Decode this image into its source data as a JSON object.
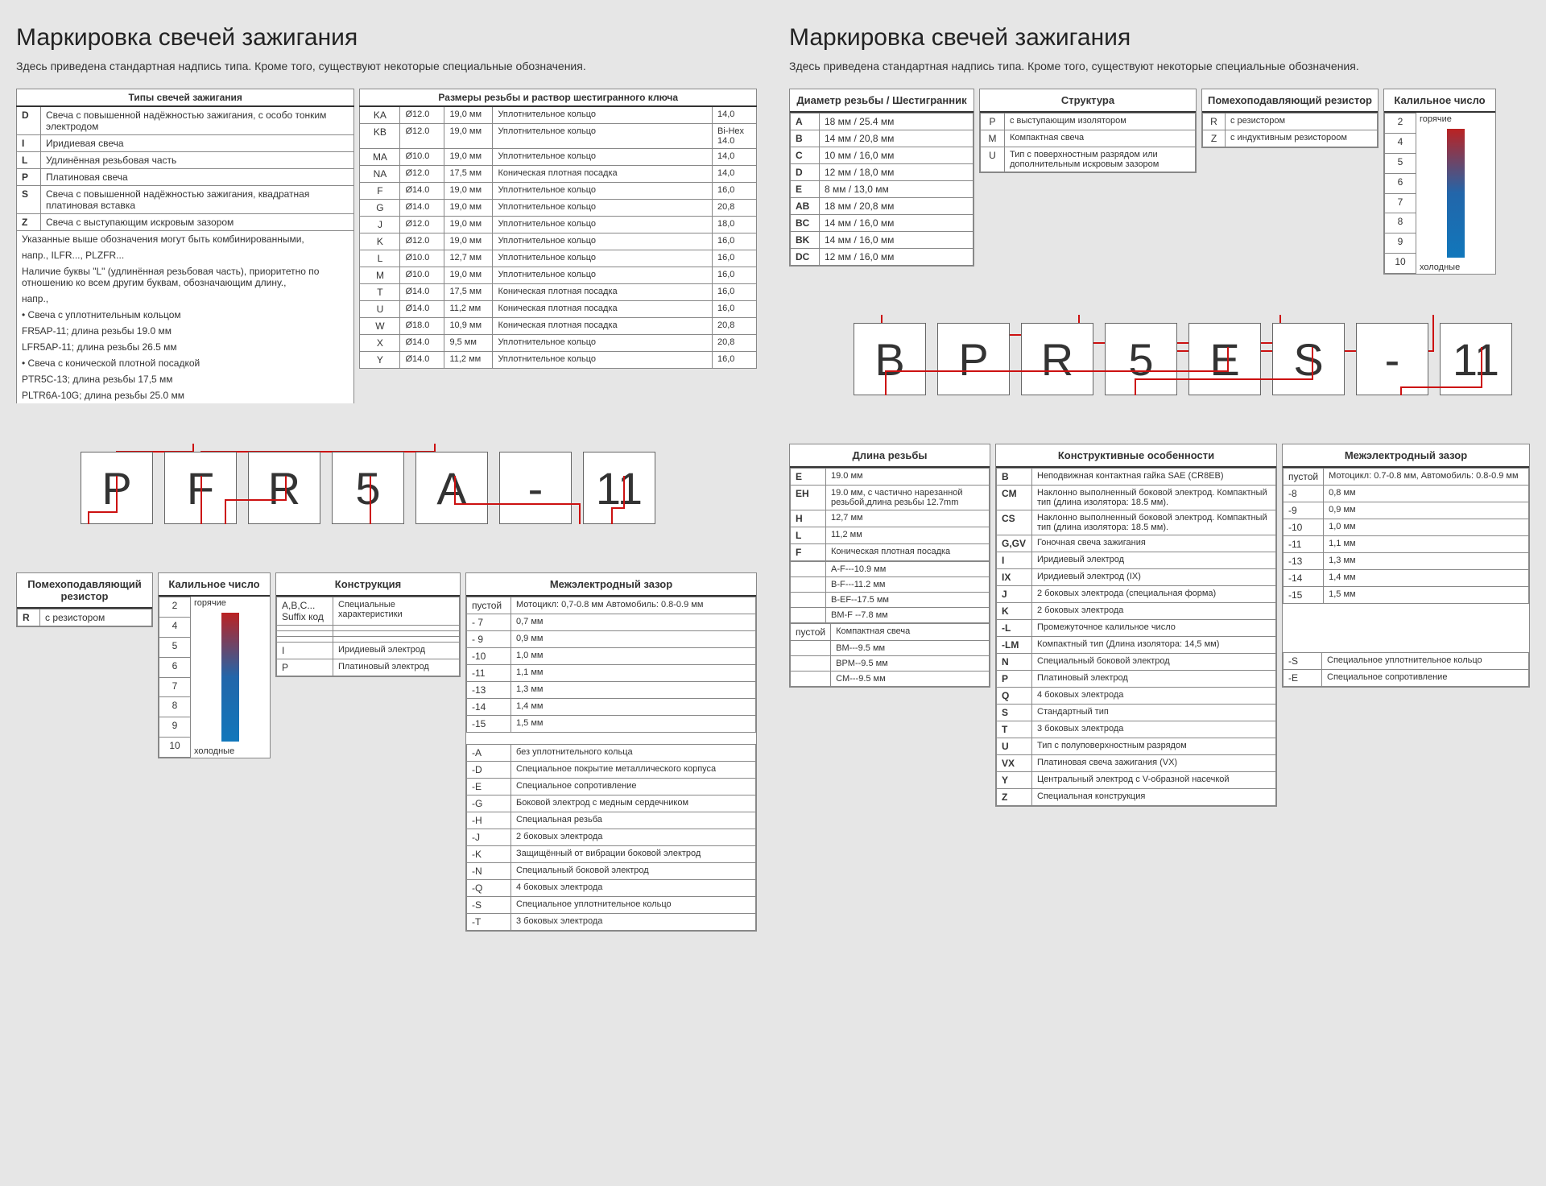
{
  "left": {
    "title": "Маркировка свечей зажигания",
    "subtitle": "Здесь приведена стандартная надпись типа. Кроме того, существуют некоторые специальные обозначения.",
    "tab1_hdr": "Типы свечей зажигания",
    "tab2_hdr": "Размеры резьбы и раствор шестигранного ключа",
    "types": [
      [
        "D",
        "Свеча с повышенной надёжностью зажигания, с особо тонким электродом"
      ],
      [
        "I",
        "Иридиевая свеча"
      ],
      [
        "L",
        "Удлинённая резьбовая часть"
      ],
      [
        "P",
        "Платиновая свеча"
      ],
      [
        "S",
        "Свеча с повышенной надёжностью зажигания, квадратная платиновая вставка"
      ],
      [
        "Z",
        "Свеча с выступающим искровым зазором"
      ]
    ],
    "types_notes": [
      "Указанные выше обозначения могут быть комбинированными,",
      "напр., ILFR..., PLZFR...",
      "Наличие буквы \"L\" (удлинённая резьбовая часть), приоритетно по отношению ко всем другим буквам, обозначающим длину.,",
      "напр.,",
      "• Свеча с уплотнительным кольцом",
      "  FR5AP-11; длина резьбы 19.0 мм",
      "  LFR5AP-11; длина резьбы 26.5 мм",
      "• Свеча с конической плотной посадкой",
      "  PTR5C-13; длина резьбы 17,5 мм",
      "  PLTR6A-10G; длина резьбы 25.0 мм"
    ],
    "sizes": [
      [
        "KA",
        "Ø12.0",
        "19,0 мм",
        "Уплотнительное кольцо",
        "14,0"
      ],
      [
        "KB",
        "Ø12.0",
        "19,0 мм",
        "Уплотнительное кольцо",
        "Bi-Hex 14.0"
      ],
      [
        "MA",
        "Ø10.0",
        "19,0 мм",
        "Уплотнительное кольцо",
        "14,0"
      ],
      [
        "NA",
        "Ø12.0",
        "17,5 мм",
        "Коническая плотная посадка",
        "14,0"
      ],
      [
        "F",
        "Ø14.0",
        "19,0 мм",
        "Уплотнительное кольцо",
        "16,0"
      ],
      [
        "G",
        "Ø14.0",
        "19,0 мм",
        "Уплотнительное кольцо",
        "20,8"
      ],
      [
        "J",
        "Ø12.0",
        "19,0 мм",
        "Уплотнительное кольцо",
        "18,0"
      ],
      [
        "K",
        "Ø12.0",
        "19,0 мм",
        "Уплотнительное кольцо",
        "16,0"
      ],
      [
        "L",
        "Ø10.0",
        "12,7 мм",
        "Уплотнительное кольцо",
        "16,0"
      ],
      [
        "M",
        "Ø10.0",
        "19,0 мм",
        "Уплотнительное кольцо",
        "16,0"
      ],
      [
        "T",
        "Ø14.0",
        "17,5 мм",
        "Коническая плотная посадка",
        "16,0"
      ],
      [
        "U",
        "Ø14.0",
        "11,2 мм",
        "Коническая плотная посадка",
        "16,0"
      ],
      [
        "W",
        "Ø18.0",
        "10,9 мм",
        "Коническая плотная посадка",
        "20,8"
      ],
      [
        "X",
        "Ø14.0",
        "9,5 мм",
        "Уплотнительное кольцо",
        "20,8"
      ],
      [
        "Y",
        "Ø14.0",
        "11,2 мм",
        "Уплотнительное кольцо",
        "16,0"
      ]
    ],
    "example": [
      "P",
      "F",
      "R",
      "5",
      "A",
      "-",
      "11"
    ],
    "resistor_hdr": "Помехоподавляющий резистор",
    "resistor": [
      [
        "R",
        "с резистором"
      ]
    ],
    "heat_hdr": "Калильное число",
    "heat_nums": [
      "2",
      "4",
      "5",
      "6",
      "7",
      "8",
      "9",
      "10"
    ],
    "heat_hot": "горячие",
    "heat_cold": "холодные",
    "constr_hdr": "Конструкция",
    "constr": [
      [
        "A,B,C...  Suffix код",
        "Специальные характеристики"
      ],
      [
        "",
        ""
      ],
      [
        "",
        ""
      ],
      [
        "",
        ""
      ],
      [
        "I",
        "Иридиевый электрод"
      ],
      [
        "P",
        "Платиновый электрод"
      ]
    ],
    "gap_hdr": "Межэлектродный зазор",
    "gap_main": [
      [
        "пустой",
        "Мотоцикл: 0,7-0.8 мм Автомобиль: 0.8-0.9 мм"
      ],
      [
        "- 7",
        "0,7 мм"
      ],
      [
        "- 9",
        "0,9 мм"
      ],
      [
        "-10",
        "1,0 мм"
      ],
      [
        "-11",
        "1,1 мм"
      ],
      [
        "-13",
        "1,3 мм"
      ],
      [
        "-14",
        "1,4 мм"
      ],
      [
        "-15",
        "1,5 мм"
      ]
    ],
    "gap_extra": [
      [
        "-A",
        "без уплотнительного кольца"
      ],
      [
        "-D",
        "Специальное покрытие металлического корпуса"
      ],
      [
        "-E",
        "Специальное сопротивление"
      ],
      [
        "-G",
        "Боковой электрод с медным сердечником"
      ],
      [
        "-H",
        "Специальная резьба"
      ],
      [
        "-J",
        "2 боковых электрода"
      ],
      [
        "-K",
        "Защищённый от вибрации боковой электрод"
      ],
      [
        "-N",
        "Специальный боковой электрод"
      ],
      [
        "-Q",
        "4 боковых электрода"
      ],
      [
        "-S",
        "Специальное уплотнительное кольцо"
      ],
      [
        "-T",
        "3 боковых электрода"
      ]
    ]
  },
  "right": {
    "title": "Маркировка свечей зажигания",
    "subtitle": "Здесь приведена стандартная надпись типа. Кроме того, существуют некоторые специальные обозначения.",
    "thread_hdr": "Диаметр резьбы / Шестигранник",
    "thread": [
      [
        "A",
        "18 мм / 25.4 мм"
      ],
      [
        "B",
        "14 мм / 20,8 мм"
      ],
      [
        "C",
        "10 мм / 16,0 мм"
      ],
      [
        "D",
        "12 мм / 18,0 мм"
      ],
      [
        "E",
        "8 мм / 13,0 мм"
      ],
      [
        "AB",
        "18 мм / 20,8 мм"
      ],
      [
        "BC",
        "14 мм / 16,0 мм"
      ],
      [
        "BK",
        "14 мм / 16,0 мм"
      ],
      [
        "DC",
        "12 мм / 16,0 мм"
      ]
    ],
    "struct_hdr": "Структура",
    "struct": [
      [
        "P",
        "с выступающим изолятором"
      ],
      [
        "M",
        "Компактная свеча"
      ],
      [
        "U",
        "Тип с поверхностным разрядом или дополнительным искровым зазором"
      ]
    ],
    "resistor_hdr": "Помехоподавляющий резистор",
    "resistor": [
      [
        "R",
        "с резистором"
      ],
      [
        "Z",
        "с индуктивным резистороом"
      ]
    ],
    "heat_hdr": "Калильное число",
    "heat_nums": [
      "2",
      "4",
      "5",
      "6",
      "7",
      "8",
      "9",
      "10"
    ],
    "heat_hot": "горячие",
    "heat_cold": "холодные",
    "example": [
      "B",
      "P",
      "R",
      "5",
      "E",
      "S",
      "-",
      "11"
    ],
    "len_hdr": "Длина резьбы",
    "len": [
      [
        "E",
        "19.0 мм"
      ],
      [
        "EH",
        "19.0 мм, с частично нарезанной резьбой,длина резьбы 12.7mm"
      ],
      [
        "H",
        "12,7 мм"
      ],
      [
        "L",
        "11,2 мм"
      ],
      [
        "F",
        "Коническая плотная посадка"
      ]
    ],
    "len_sub": [
      [
        "",
        "A-F---10.9 мм"
      ],
      [
        "",
        "B-F---11.2 мм"
      ],
      [
        "",
        "B-EF--17.5 мм"
      ],
      [
        "",
        "BM-F --7.8 мм"
      ]
    ],
    "len2": [
      [
        "пустой",
        "Компактная свеча"
      ],
      [
        "",
        "BM---9.5 мм"
      ],
      [
        "",
        "BPM--9.5 мм"
      ],
      [
        "",
        "CM---9.5 мм"
      ]
    ],
    "feat_hdr": "Конструктивные особенности",
    "feat": [
      [
        "B",
        "Неподвижная контактная гайка SAE (CR8EB)"
      ],
      [
        "CM",
        "Наклонно выполненный боковой электрод. Компактный тип (длина изолятора: 18.5 мм)."
      ],
      [
        "CS",
        "Наклонно выполненный боковой электрод. Компактный тип (длина изолятора: 18.5 мм)."
      ],
      [
        "G,GV",
        "Гоночная свеча зажигания"
      ],
      [
        "I",
        "Иридиевый электрод"
      ],
      [
        "IX",
        "Иридиевый электрод (IX)"
      ],
      [
        "J",
        "2 боковых электрода (специальная форма)"
      ],
      [
        "K",
        "2 боковых электрода"
      ],
      [
        "-L",
        "Промежуточное калильное число"
      ],
      [
        "-LM",
        "Компактный тип (Длина изолятора: 14,5 мм)"
      ],
      [
        "N",
        "Специальный боковой электрод"
      ],
      [
        "P",
        "Платиновый электрод"
      ],
      [
        "Q",
        "4 боковых электрода"
      ],
      [
        "S",
        "Стандартный тип"
      ],
      [
        "T",
        "3 боковых электрода"
      ],
      [
        "U",
        "Тип с полуповерхностным разрядом"
      ],
      [
        "VX",
        "Платиновая свеча зажигания (VX)"
      ],
      [
        "Y",
        "Центральный электрод с V-образной насечкой"
      ],
      [
        "Z",
        "Специальная конструкция"
      ]
    ],
    "gap_hdr": "Межэлектродный зазор",
    "gap": [
      [
        "пустой",
        "Мотоцикл: 0.7-0.8 мм, Автомобиль: 0.8-0.9 мм"
      ],
      [
        "-8",
        "0,8 мм"
      ],
      [
        "-9",
        "0,9 мм"
      ],
      [
        "-10",
        "1,0 мм"
      ],
      [
        "-11",
        "1,1 мм"
      ],
      [
        "-13",
        "1,3 мм"
      ],
      [
        "-14",
        "1,4 мм"
      ],
      [
        "-15",
        "1,5 мм"
      ]
    ],
    "gap_extra": [
      [
        "-S",
        "Специальное уплотнительное кольцо"
      ],
      [
        "-E",
        "Специальное сопротивление"
      ]
    ]
  }
}
